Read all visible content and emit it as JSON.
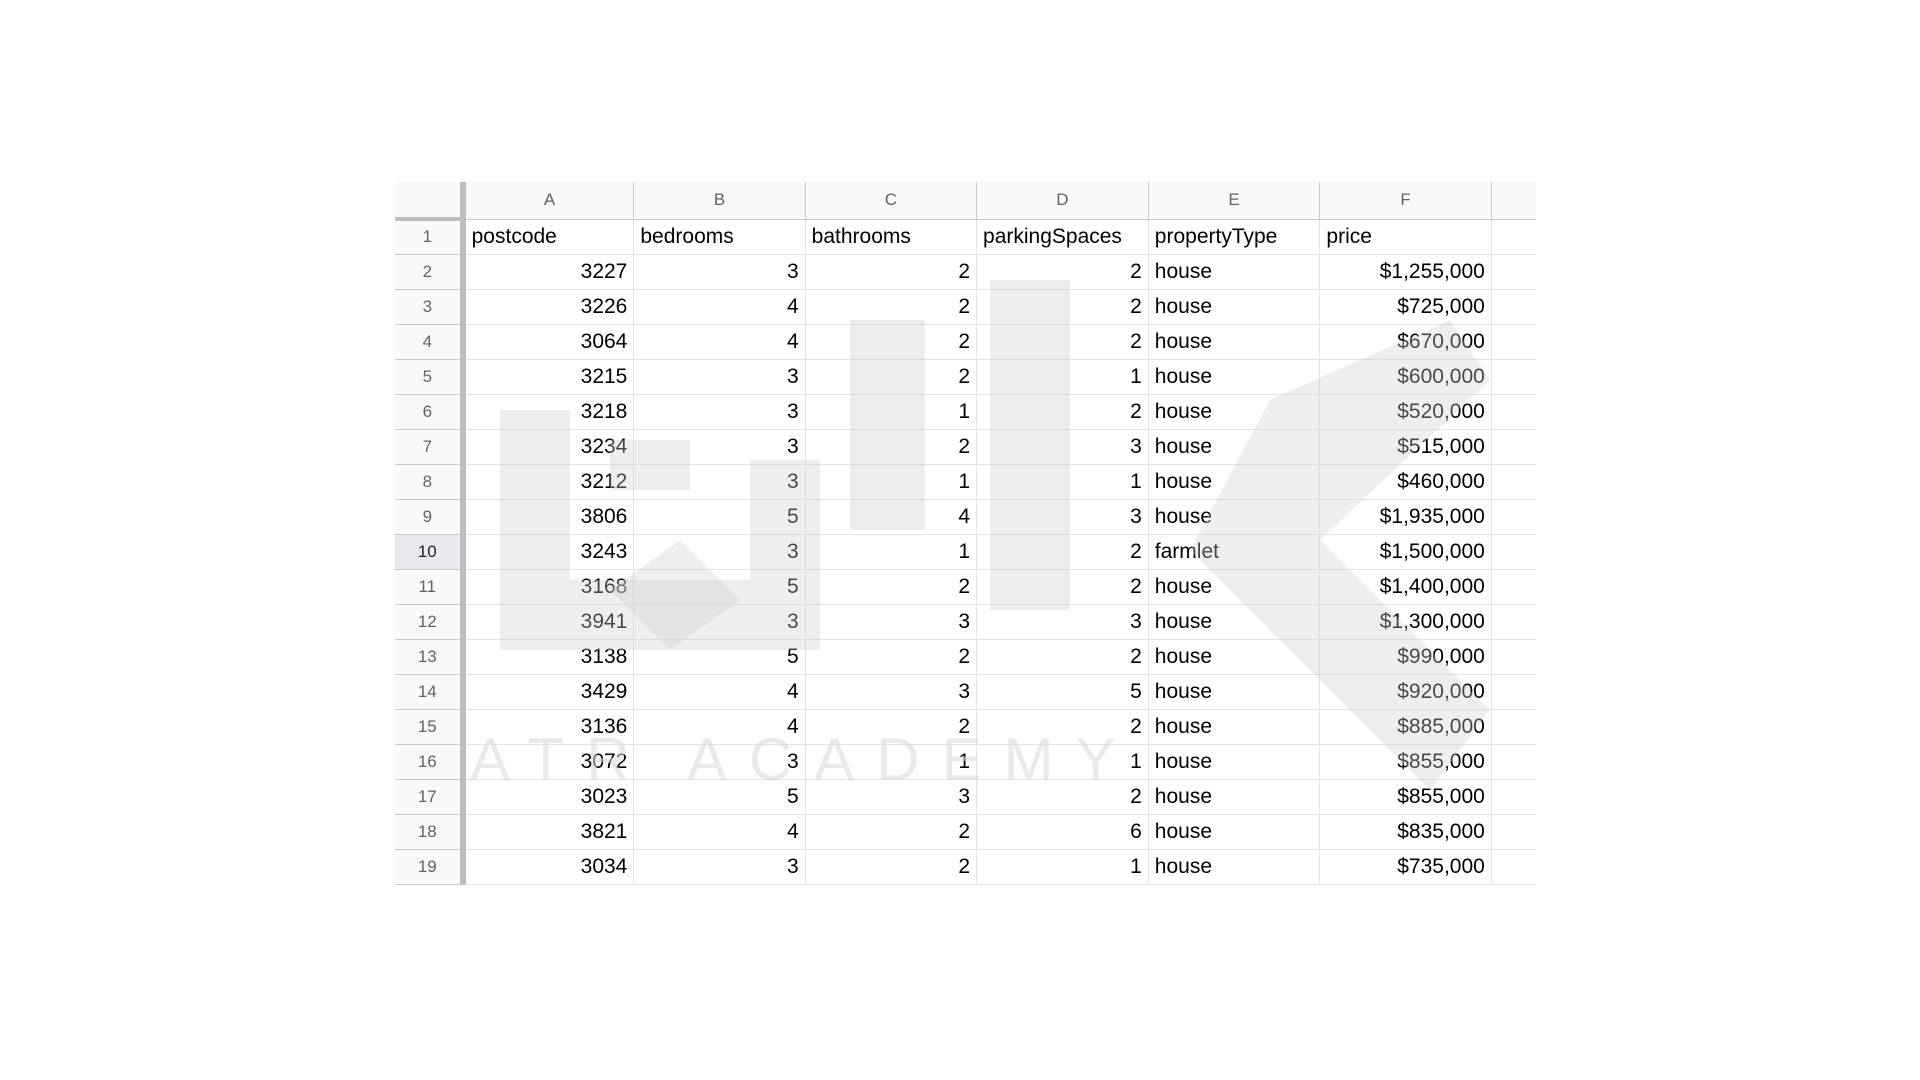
{
  "columns": [
    "A",
    "B",
    "C",
    "D",
    "E",
    "F"
  ],
  "rows": [
    {
      "num": "1",
      "cells": [
        "postcode",
        "bedrooms",
        "bathrooms",
        "parkingSpaces",
        "propertyType",
        "price"
      ],
      "header": true
    },
    {
      "num": "2",
      "cells": [
        "3227",
        "3",
        "2",
        "2",
        "house",
        "$1,255,000"
      ]
    },
    {
      "num": "3",
      "cells": [
        "3226",
        "4",
        "2",
        "2",
        "house",
        "$725,000"
      ]
    },
    {
      "num": "4",
      "cells": [
        "3064",
        "4",
        "2",
        "2",
        "house",
        "$670,000"
      ]
    },
    {
      "num": "5",
      "cells": [
        "3215",
        "3",
        "2",
        "1",
        "house",
        "$600,000"
      ]
    },
    {
      "num": "6",
      "cells": [
        "3218",
        "3",
        "1",
        "2",
        "house",
        "$520,000"
      ]
    },
    {
      "num": "7",
      "cells": [
        "3234",
        "3",
        "2",
        "3",
        "house",
        "$515,000"
      ]
    },
    {
      "num": "8",
      "cells": [
        "3212",
        "3",
        "1",
        "1",
        "house",
        "$460,000"
      ]
    },
    {
      "num": "9",
      "cells": [
        "3806",
        "5",
        "4",
        "3",
        "house",
        "$1,935,000"
      ]
    },
    {
      "num": "10",
      "cells": [
        "3243",
        "3",
        "1",
        "2",
        "farmlet",
        "$1,500,000"
      ],
      "selected": true
    },
    {
      "num": "11",
      "cells": [
        "3168",
        "5",
        "2",
        "2",
        "house",
        "$1,400,000"
      ]
    },
    {
      "num": "12",
      "cells": [
        "3941",
        "3",
        "3",
        "3",
        "house",
        "$1,300,000"
      ]
    },
    {
      "num": "13",
      "cells": [
        "3138",
        "5",
        "2",
        "2",
        "house",
        "$990,000"
      ]
    },
    {
      "num": "14",
      "cells": [
        "3429",
        "4",
        "3",
        "5",
        "house",
        "$920,000"
      ]
    },
    {
      "num": "15",
      "cells": [
        "3136",
        "4",
        "2",
        "2",
        "house",
        "$885,000"
      ]
    },
    {
      "num": "16",
      "cells": [
        "3072",
        "3",
        "1",
        "1",
        "house",
        "$855,000"
      ]
    },
    {
      "num": "17",
      "cells": [
        "3023",
        "5",
        "3",
        "2",
        "house",
        "$855,000"
      ]
    },
    {
      "num": "18",
      "cells": [
        "3821",
        "4",
        "2",
        "6",
        "house",
        "$835,000"
      ]
    },
    {
      "num": "19",
      "cells": [
        "3034",
        "3",
        "2",
        "1",
        "house",
        "$735,000"
      ]
    }
  ],
  "colors": {
    "header_bg": "#f8f9fa",
    "gridline": "#e2e3e3",
    "header_text": "#5f6368",
    "watermark": "#e9e9e9"
  },
  "watermark": {
    "text": "ATR   ACADEMY",
    "icon": "academy-logo-watermark"
  }
}
